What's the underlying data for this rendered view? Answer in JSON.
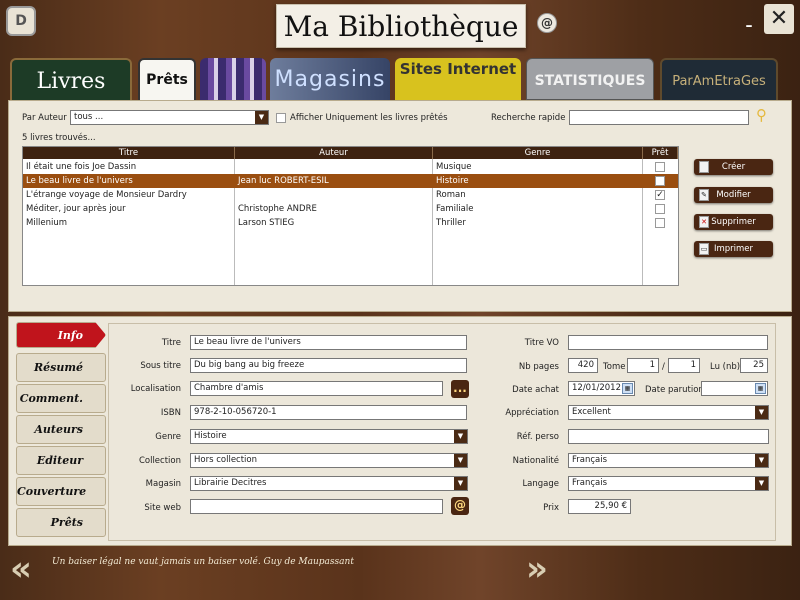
{
  "header": {
    "logo": "D",
    "title": "Ma Bibliothèque",
    "at_symbol": "@",
    "minimize": "–",
    "close": "✕"
  },
  "main_tabs": {
    "livres": "Livres",
    "prets": "Prêts",
    "magasins": "Magasins",
    "sites": "Sites Internet",
    "statistiques": "STATISTIQUES",
    "parametrages": "ParAmEtraGes"
  },
  "filters": {
    "by_author_label": "Par Auteur",
    "author_value": "tous ...",
    "only_loaned_label": "Afficher Uniquement les livres prêtés",
    "quick_search_label": "Recherche rapide",
    "quick_search_value": ""
  },
  "results_count": "5 livres trouvés...",
  "grid": {
    "headers": [
      "Titre",
      "Auteur",
      "Genre",
      "Prêt"
    ],
    "rows": [
      {
        "titre": "Il était une fois Joe Dassin",
        "auteur": "",
        "genre": "Musique",
        "pret": ""
      },
      {
        "titre": "Le beau livre de l'univers",
        "auteur": "Jean luc ROBERT-ESIL",
        "genre": "Histoire",
        "pret": ""
      },
      {
        "titre": "L'étrange voyage de Monsieur Dardry",
        "auteur": "",
        "genre": "Roman",
        "pret": "✓"
      },
      {
        "titre": "Méditer, jour après jour",
        "auteur": "Christophe ANDRE",
        "genre": "Familiale",
        "pret": ""
      },
      {
        "titre": "Millenium",
        "auteur": "Larson STIEG",
        "genre": "Thriller",
        "pret": ""
      }
    ]
  },
  "actions": {
    "creer": "Créer",
    "modifier": "Modifier",
    "supprimer": "Supprimer",
    "imprimer": "Imprimer"
  },
  "side_tabs": [
    "Info",
    "Résumé",
    "Comment.",
    "Auteurs",
    "Editeur",
    "Couverture",
    "Prêts"
  ],
  "form": {
    "titre_label": "Titre",
    "titre": "Le beau livre de l'univers",
    "sous_titre_label": "Sous titre",
    "sous_titre": "Du big bang au big freeze",
    "localisation_label": "Localisation",
    "localisation": "Chambre d'amis",
    "ellipsis": "...",
    "isbn_label": "ISBN",
    "isbn": "978-2-10-056720-1",
    "genre_label": "Genre",
    "genre": "Histoire",
    "collection_label": "Collection",
    "collection": "Hors collection",
    "magasin_label": "Magasin",
    "magasin": "Librairie Decitres",
    "site_web_label": "Site web",
    "site_web": "",
    "site_at": "@",
    "titre_vo_label": "Titre VO",
    "titre_vo": "",
    "nb_pages_label": "Nb pages",
    "nb_pages": "420",
    "tome_label": "Tome",
    "tome": "1",
    "tome_sep": "/",
    "tome_total": "1",
    "lu_label": "Lu (nb)",
    "lu": "25",
    "date_achat_label": "Date achat",
    "date_achat": "12/01/2012",
    "date_parution_label": "Date parution",
    "date_parution": "",
    "appreciation_label": "Appréciation",
    "appreciation": "Excellent",
    "ref_perso_label": "Réf. perso",
    "ref_perso": "",
    "nationalite_label": "Nationalité",
    "nationalite": "Français",
    "langage_label": "Langage",
    "langage": "Français",
    "prix_label": "Prix",
    "prix": "25,90 €"
  },
  "footer": {
    "quote": "Un baiser légal ne vaut jamais un baiser volé. Guy de Maupassant",
    "prev": "«",
    "next": "»"
  }
}
